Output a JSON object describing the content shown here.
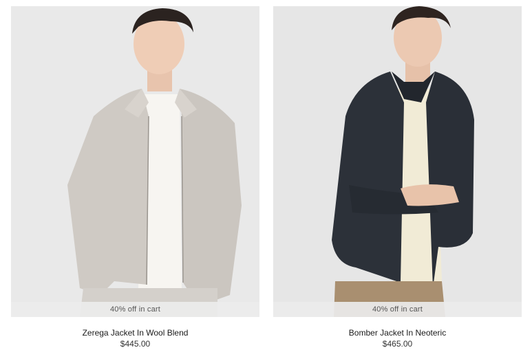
{
  "products": [
    {
      "name": "Zerega Jacket In Wool Blend",
      "price": "$445.00",
      "promo": "40% off in cart",
      "image": "man-in-light-grey-zip-jacket"
    },
    {
      "name": "Bomber Jacket In Neoteric",
      "price": "$465.00",
      "promo": "40% off in cart",
      "image": "man-in-navy-bomber-jacket"
    }
  ]
}
